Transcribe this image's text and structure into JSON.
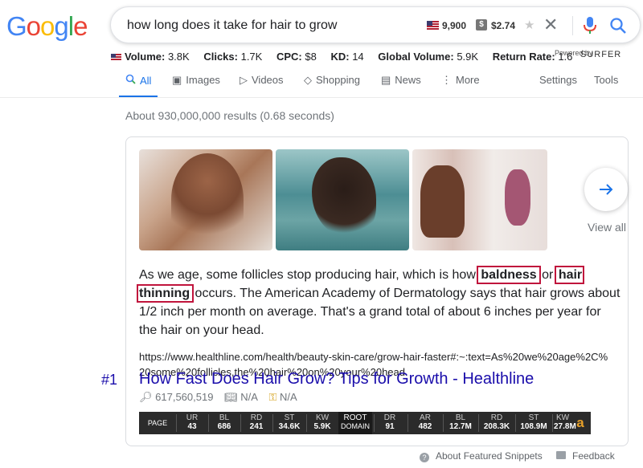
{
  "logo": "Google",
  "search": {
    "query": "how long does it take for hair to grow",
    "volume": "9,900",
    "cpc": "$2.74"
  },
  "metrics": {
    "volume_label": "Volume:",
    "volume_value": "3.8K",
    "clicks_label": "Clicks:",
    "clicks_value": "1.7K",
    "cpc_label": "CPC:",
    "cpc_value": "$8",
    "kd_label": "KD:",
    "kd_value": "14",
    "global_label": "Global Volume:",
    "global_value": "5.9K",
    "return_label": "Return Rate:",
    "return_value": "1.6",
    "powered_by": "Powered by",
    "surfer": "SURFER"
  },
  "tabs": {
    "all": "All",
    "images": "Images",
    "videos": "Videos",
    "shopping": "Shopping",
    "news": "News",
    "more": "More",
    "settings": "Settings",
    "tools": "Tools"
  },
  "stats": "About 930,000,000 results (0.68 seconds)",
  "snippet": {
    "view_all": "View all",
    "text_before": "As we age, some follicles stop producing hair, which is how ",
    "hl1": "baldness",
    "text_mid": " or ",
    "hl2": "hair thinning",
    "text_after": " occurs. The American Academy of Dermatology says that hair grows about 1/2 inch per month on average. That's a grand total of about 6 inches per year for the hair on your head.",
    "url": "https://www.healthline.com/health/beauty-skin-care/grow-hair-faster#:~:text=As%20we%20age%2C%20some%20follicles,the%20hair%20on%20your%20head.",
    "rank": "#1",
    "title": "How Fast Does Hair Grow? Tips for Growth - Healthline",
    "mini_score": "617,560,519",
    "mini_book": "N/A",
    "mini_key": "N/A"
  },
  "ahrefs_bar": {
    "page": "PAGE",
    "ur_label": "UR",
    "ur": "43",
    "bl_label": "BL",
    "bl": "686",
    "rd_label": "RD",
    "rd": "241",
    "st_label": "ST",
    "st": "34.6K",
    "kw_label": "KW",
    "kw": "5.9K",
    "root_line1": "ROOT",
    "root_line2": "DOMAIN",
    "dr_label": "DR",
    "dr": "91",
    "ar_label": "AR",
    "ar": "482",
    "dbl_label": "BL",
    "dbl": "12.7M",
    "drd_label": "RD",
    "drd": "208.3K",
    "dst_label": "ST",
    "dst": "108.9M",
    "dkw_label": "KW",
    "dkw": "27.8M",
    "logo": "a"
  },
  "footer": {
    "about": "About Featured Snippets",
    "feedback": "Feedback"
  },
  "colors": {
    "link": "#1a0dab",
    "accent": "#1a73e8",
    "highlight_border": "#c0143c"
  }
}
